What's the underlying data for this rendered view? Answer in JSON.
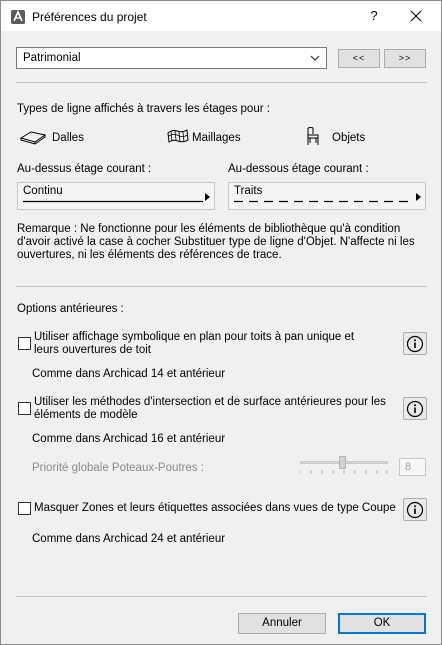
{
  "window": {
    "title": "Préférences du projet",
    "help_label": "?"
  },
  "preset": {
    "selected": "Patrimonial",
    "prev_label": "<<",
    "next_label": ">>"
  },
  "line_types": {
    "heading": "Types de ligne affichés à travers les étages pour :",
    "element_types": [
      {
        "label": "Dalles",
        "icon": "slab-icon"
      },
      {
        "label": "Maillages",
        "icon": "mesh-icon"
      },
      {
        "label": "Objets",
        "icon": "chair-icon"
      }
    ],
    "above": {
      "label": "Au-dessus étage courant :",
      "value": "Continu"
    },
    "below": {
      "label": "Au-dessous étage courant :",
      "value": "Traits"
    },
    "remark": [
      "Remarque : Ne fonctionne pour les éléments de bibliothèque qu'à condition",
      "d'avoir activé la case à cocher Substituer type de ligne d'Objet. N'affecte ni les",
      "ouvertures, ni les éléments des références de trace."
    ]
  },
  "legacy": {
    "heading": "Options antérieures :",
    "options": [
      {
        "label_lines": [
          "Utiliser affichage symbolique en plan pour toits à pan unique et",
          "leurs ouvertures de toit"
        ],
        "note": "Comme dans Archicad 14 et antérieur",
        "checked": false
      },
      {
        "label_lines": [
          "Utiliser les méthodes d'intersection et de surface antérieures pour les",
          "éléments de modèle"
        ],
        "note": "Comme dans Archicad 16 et antérieur",
        "checked": false
      },
      {
        "label_lines": [
          "Masquer Zones et leurs étiquettes associées dans vues de type Coupe"
        ],
        "note": "Comme dans Archicad 24 et antérieur",
        "checked": false
      }
    ],
    "priority": {
      "label": "Priorité globale Poteaux-Poutres :",
      "value": "8",
      "slider_fraction": 0.5,
      "enabled": false
    }
  },
  "footer": {
    "cancel_label": "Annuler",
    "ok_label": "OK"
  },
  "colors": {
    "dialog_bg": "#f0f0f0",
    "focus_border": "#0078d7",
    "disabled_text": "#8b8b8b"
  }
}
